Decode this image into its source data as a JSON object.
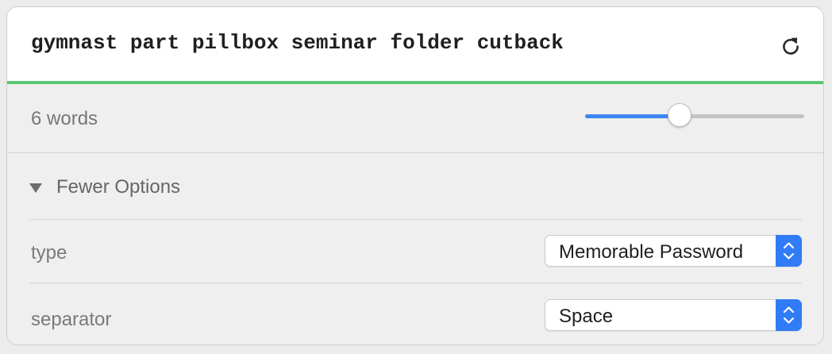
{
  "password": {
    "text": "gymnast part pillbox seminar folder cutback",
    "strength_color": "#5ac873"
  },
  "icons": {
    "refresh": "refresh-icon",
    "disclosure": "disclosure-triangle-down-icon",
    "select_arrows": "up-down-chevron-icon"
  },
  "length": {
    "label": "6 words",
    "slider_fraction": 0.43,
    "accent_color": "#3d86f0"
  },
  "options": {
    "toggle_label": "Fewer Options",
    "type": {
      "label": "type",
      "value": "Memorable Password"
    },
    "separator": {
      "label": "separator",
      "value": "Space"
    }
  }
}
